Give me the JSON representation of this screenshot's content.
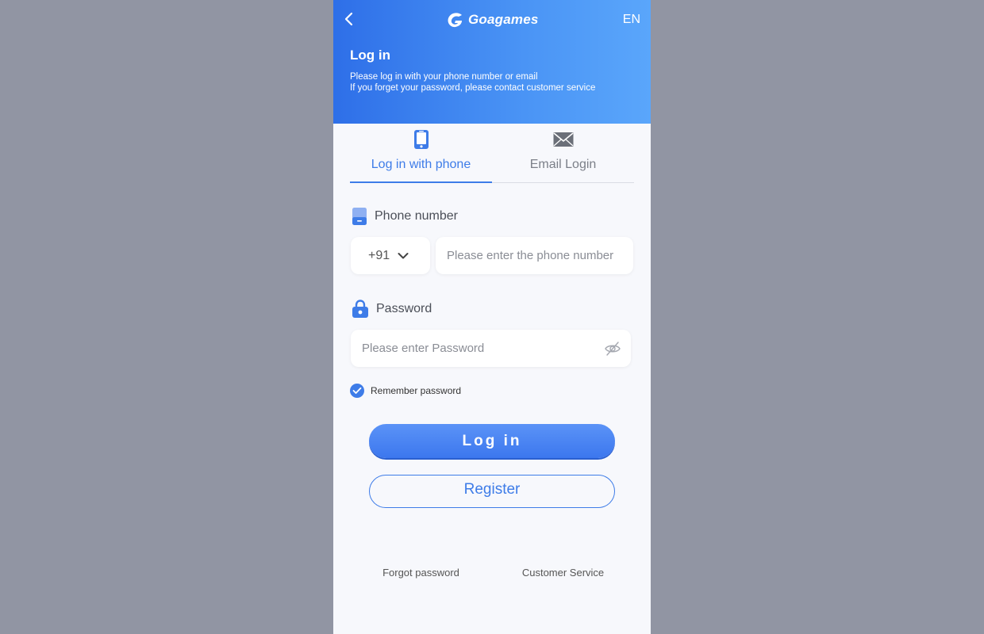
{
  "header": {
    "brand": "Goagames",
    "language": "EN",
    "title": "Log in",
    "subtitle_line1": "Please log in with your phone number or email",
    "subtitle_line2": "If you forget your password, please contact customer service"
  },
  "tabs": [
    {
      "label": "Log in with phone",
      "icon": "phone-icon",
      "active": true
    },
    {
      "label": "Email Login",
      "icon": "envelope-icon",
      "active": false
    }
  ],
  "form": {
    "phone_label": "Phone number",
    "country_code": "+91",
    "phone_placeholder": "Please enter the phone number",
    "password_label": "Password",
    "password_placeholder": "Please enter Password",
    "remember_label": "Remember password",
    "remember_checked": true
  },
  "actions": {
    "login_label": "Log in",
    "register_label": "Register"
  },
  "footer": {
    "forgot_label": "Forgot password",
    "service_label": "Customer Service"
  },
  "colors": {
    "accent": "#3e7ce8",
    "header_start": "#2e6fe8",
    "header_end": "#5aa6fb",
    "backdrop": "#9195a3"
  }
}
